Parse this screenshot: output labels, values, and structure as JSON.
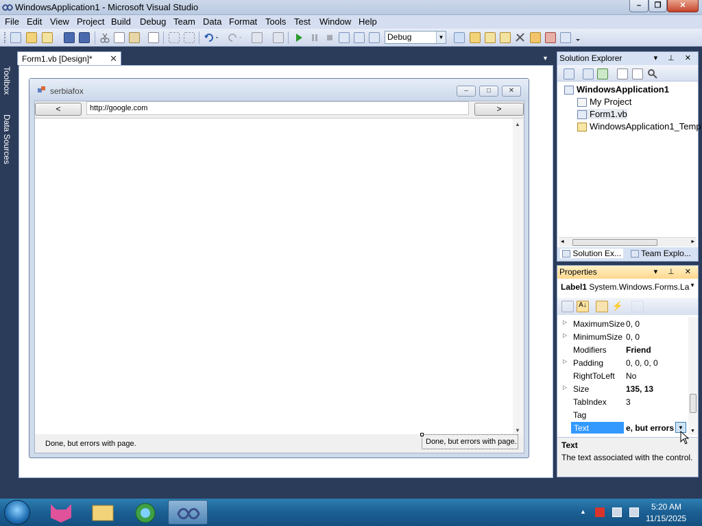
{
  "window": {
    "title": "WindowsApplication1 - Microsoft Visual Studio",
    "minimize": "–",
    "maximize": "❐",
    "close": "✕"
  },
  "menu": [
    "File",
    "Edit",
    "View",
    "Project",
    "Build",
    "Debug",
    "Team",
    "Data",
    "Format",
    "Tools",
    "Test",
    "Window",
    "Help"
  ],
  "toolbar": {
    "config": "Debug"
  },
  "leftbar": {
    "toolbox": "Toolbox",
    "data_sources": "Data Sources"
  },
  "document": {
    "tab_label": "Form1.vb [Design]*",
    "tab_close": "✕"
  },
  "form": {
    "title": "serbiafox",
    "back_label": "<",
    "forward_label": ">",
    "url": "http://google.com",
    "status_left": "Done, but errors with page.",
    "status_right": "Done, but errors with page."
  },
  "solution_explorer": {
    "title": "Solution Explorer",
    "items": [
      {
        "label": "WindowsApplication1"
      },
      {
        "label": "My Project"
      },
      {
        "label": "Form1.vb"
      },
      {
        "label": "WindowsApplication1_Temp"
      }
    ],
    "tabs": [
      "Solution Ex...",
      "Team Explo..."
    ]
  },
  "properties": {
    "title": "Properties",
    "object_name": "Label1",
    "object_type": "System.Windows.Forms.La",
    "rows": [
      {
        "name": "MaximumSize",
        "value": "0, 0"
      },
      {
        "name": "MinimumSize",
        "value": "0, 0"
      },
      {
        "name": "Modifiers",
        "value": "Friend"
      },
      {
        "name": "Padding",
        "value": "0, 0, 0, 0"
      },
      {
        "name": "RightToLeft",
        "value": "No"
      },
      {
        "name": "Size",
        "value": "135, 13"
      },
      {
        "name": "TabIndex",
        "value": "3"
      },
      {
        "name": "Tag",
        "value": ""
      },
      {
        "name": "Text",
        "value": "e, but errors"
      }
    ],
    "desc_title": "Text",
    "desc_text": "The text associated with the control."
  },
  "taskbar": {
    "time": "5:20 AM",
    "date": "11/15/2025"
  },
  "colors": {
    "ide_background": "#2b3b5a",
    "selection": "#3399ff",
    "panel_header_active": "#ffd88f"
  }
}
